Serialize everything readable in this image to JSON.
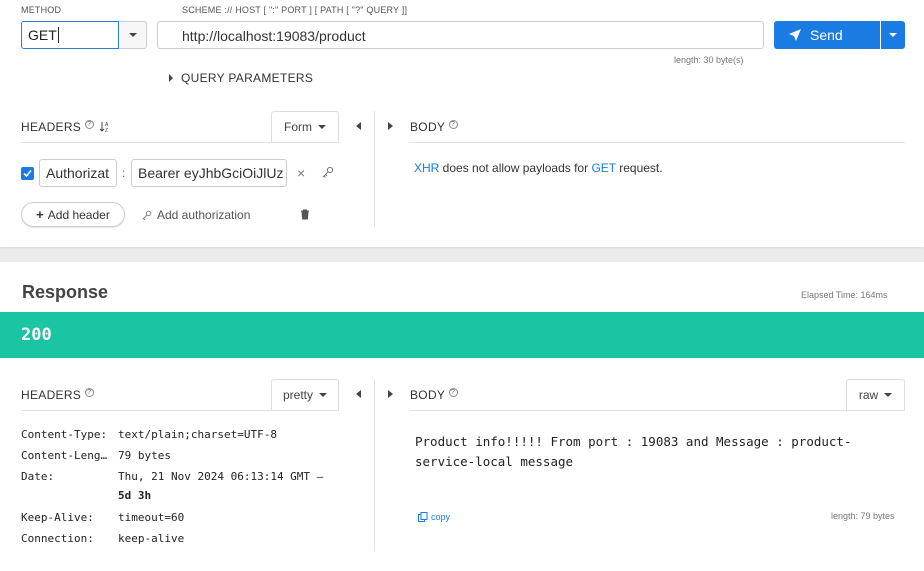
{
  "request": {
    "method_label": "METHOD",
    "method_value": "GET",
    "url_label": "SCHEME :// HOST [ \":\" PORT ] [ PATH [ \"?\" QUERY ]]",
    "url_value": "http://localhost:19083/product",
    "url_length": "length: 30 byte(s)",
    "send_label": "Send",
    "query_params_label": "QUERY PARAMETERS",
    "headers_title": "HEADERS",
    "headers_mode": "Form",
    "header_rows": [
      {
        "enabled": true,
        "name": "Authorizat",
        "separator": ":",
        "value": "Bearer eyJhbGciOiJlUz"
      }
    ],
    "add_header_label": "Add header",
    "add_authorization_label": "Add authorization",
    "body_title": "BODY",
    "body_note": {
      "xhr": "XHR",
      "middle": " does not allow payloads for ",
      "method": "GET",
      "end": " request."
    }
  },
  "response": {
    "title": "Response",
    "elapsed": "Elapsed Time: 164ms",
    "status_code": "200",
    "headers_title": "HEADERS",
    "headers_mode": "pretty",
    "headers": [
      {
        "key": "Content-Type:",
        "value": "text/plain;charset=UTF-8"
      },
      {
        "key": "Content-Leng…",
        "value": "79 bytes"
      },
      {
        "key": "Date:",
        "value": "Thu, 21 Nov 2024 06:13:14 GMT —",
        "extra": "5d 3h"
      },
      {
        "key": "Keep-Alive:",
        "value": "timeout=60"
      },
      {
        "key": "Connection:",
        "value": "keep-alive"
      }
    ],
    "body_title": "BODY",
    "body_mode": "raw",
    "body_line1": "Product info!!!!! From port : 19083 and Message : product-",
    "body_line2": "service-local message",
    "copy_label": "copy",
    "body_length": "length: 79 bytes"
  },
  "colors": {
    "accent": "#1a7be3",
    "status_ok": "#1bc4a3"
  }
}
